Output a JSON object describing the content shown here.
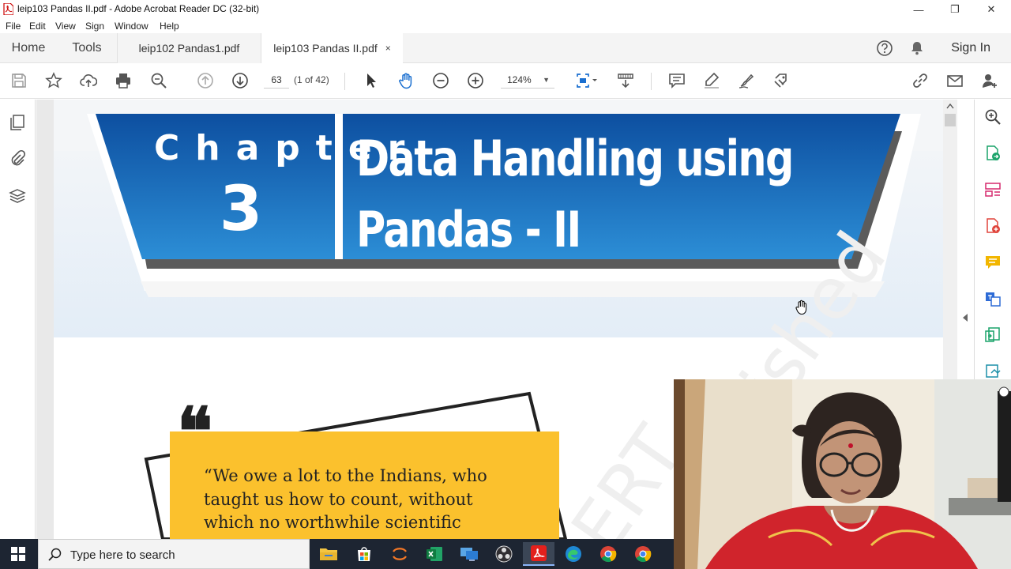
{
  "window": {
    "title": "leip103 Pandas II.pdf - Adobe Acrobat Reader DC (32-bit)",
    "minimize": "—",
    "maximize": "❐",
    "close": "✕"
  },
  "menu": [
    "File",
    "Edit",
    "View",
    "Sign",
    "Window",
    "Help"
  ],
  "tabs": {
    "home": "Home",
    "tools": "Tools",
    "docs": [
      {
        "label": "leip102 Pandas1.pdf",
        "active": false
      },
      {
        "label": "leip103 Pandas II.pdf",
        "active": true,
        "close": "×"
      }
    ],
    "sign_in": "Sign In"
  },
  "toolbar": {
    "page_number": "63",
    "page_count": "(1 of 42)",
    "zoom": "124%",
    "zoom_caret": "▼"
  },
  "document": {
    "chapter_word": "Chapter",
    "chapter_number": "3",
    "title_line1": "Data Handling using",
    "title_line2": "Pandas - II",
    "quote_mark": "❝",
    "quote_lines": [
      "“We owe a lot to the Indians, who",
      "taught us how to count, without",
      "which no worthwhile scientific"
    ],
    "watermark": "ERT ished"
  },
  "taskbar": {
    "search_placeholder": "Type here to search"
  },
  "colors": {
    "banner_blue_top": "#0d4fa0",
    "banner_blue_bottom": "#2c8ed6",
    "banner_bg_light": "#e3edf7",
    "quote_yellow": "#fbc12d",
    "webcam_dress_red": "#d0242c",
    "taskbar": "#1d2532"
  },
  "icons": {
    "toolbar": [
      "save-icon",
      "star-icon",
      "upload-icon",
      "print-icon",
      "zoom-search-icon",
      "page-up-icon",
      "page-down-icon",
      "select-arrow-icon",
      "hand-icon",
      "zoom-out-icon",
      "zoom-in-icon",
      "fit-page-icon",
      "scroll-mode-icon",
      "comment-icon",
      "highlight-icon",
      "draw-icon",
      "stamp-icon",
      "link-icon",
      "mail-icon",
      "add-user-icon"
    ],
    "left_panel": [
      "pages-icon",
      "attachment-icon",
      "layers-icon"
    ],
    "right_panel": [
      "zoom-panel-icon",
      "export-pdf-icon",
      "organize-icon",
      "create-pdf-icon",
      "comment-panel-icon",
      "translate-icon",
      "compress-icon",
      "send-icon"
    ]
  }
}
